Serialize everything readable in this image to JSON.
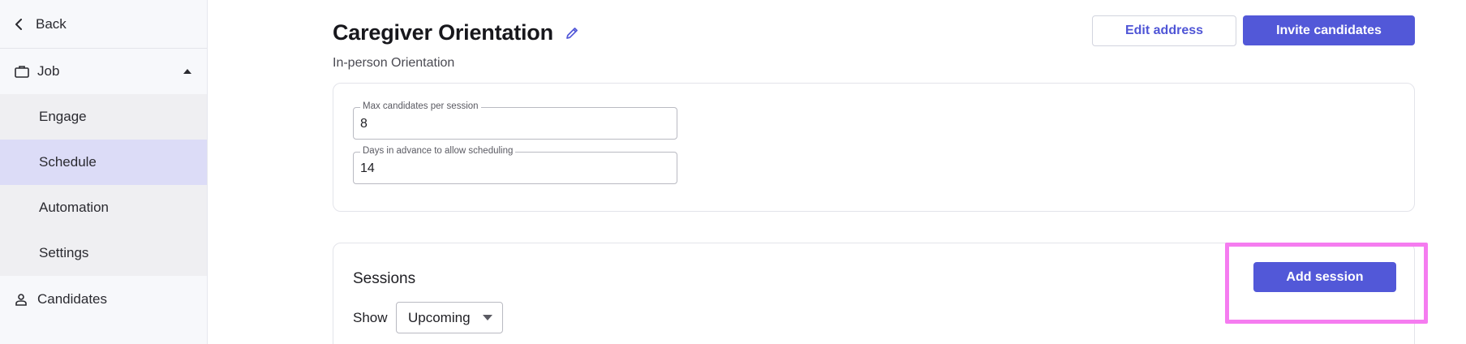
{
  "sidebar": {
    "back_label": "Back",
    "job_label": "Job",
    "subitems": [
      {
        "label": "Engage"
      },
      {
        "label": "Schedule"
      },
      {
        "label": "Automation"
      },
      {
        "label": "Settings"
      }
    ],
    "active_item": "Schedule",
    "candidates_label": "Candidates"
  },
  "header": {
    "title": "Caregiver Orientation",
    "subtitle": "In-person Orientation",
    "edit_address_label": "Edit address",
    "invite_candidates_label": "Invite candidates"
  },
  "settings_card": {
    "max_candidates": {
      "label": "Max candidates per session",
      "value": "8"
    },
    "days_in_advance": {
      "label": "Days in advance to allow scheduling",
      "value": "14"
    }
  },
  "sessions": {
    "title": "Sessions",
    "add_session_label": "Add session",
    "show_label": "Show",
    "filter_value": "Upcoming"
  },
  "colors": {
    "accent": "#5258d8",
    "active_nav_bg": "#dcdcf7",
    "highlight": "#f57cf0"
  },
  "icons": {
    "back": "chevron-left-icon",
    "job": "briefcase-icon",
    "job_toggle": "caret-up-icon",
    "candidates": "person-icon",
    "edit_title": "pencil-icon",
    "filter_dropdown": "caret-down-icon"
  }
}
